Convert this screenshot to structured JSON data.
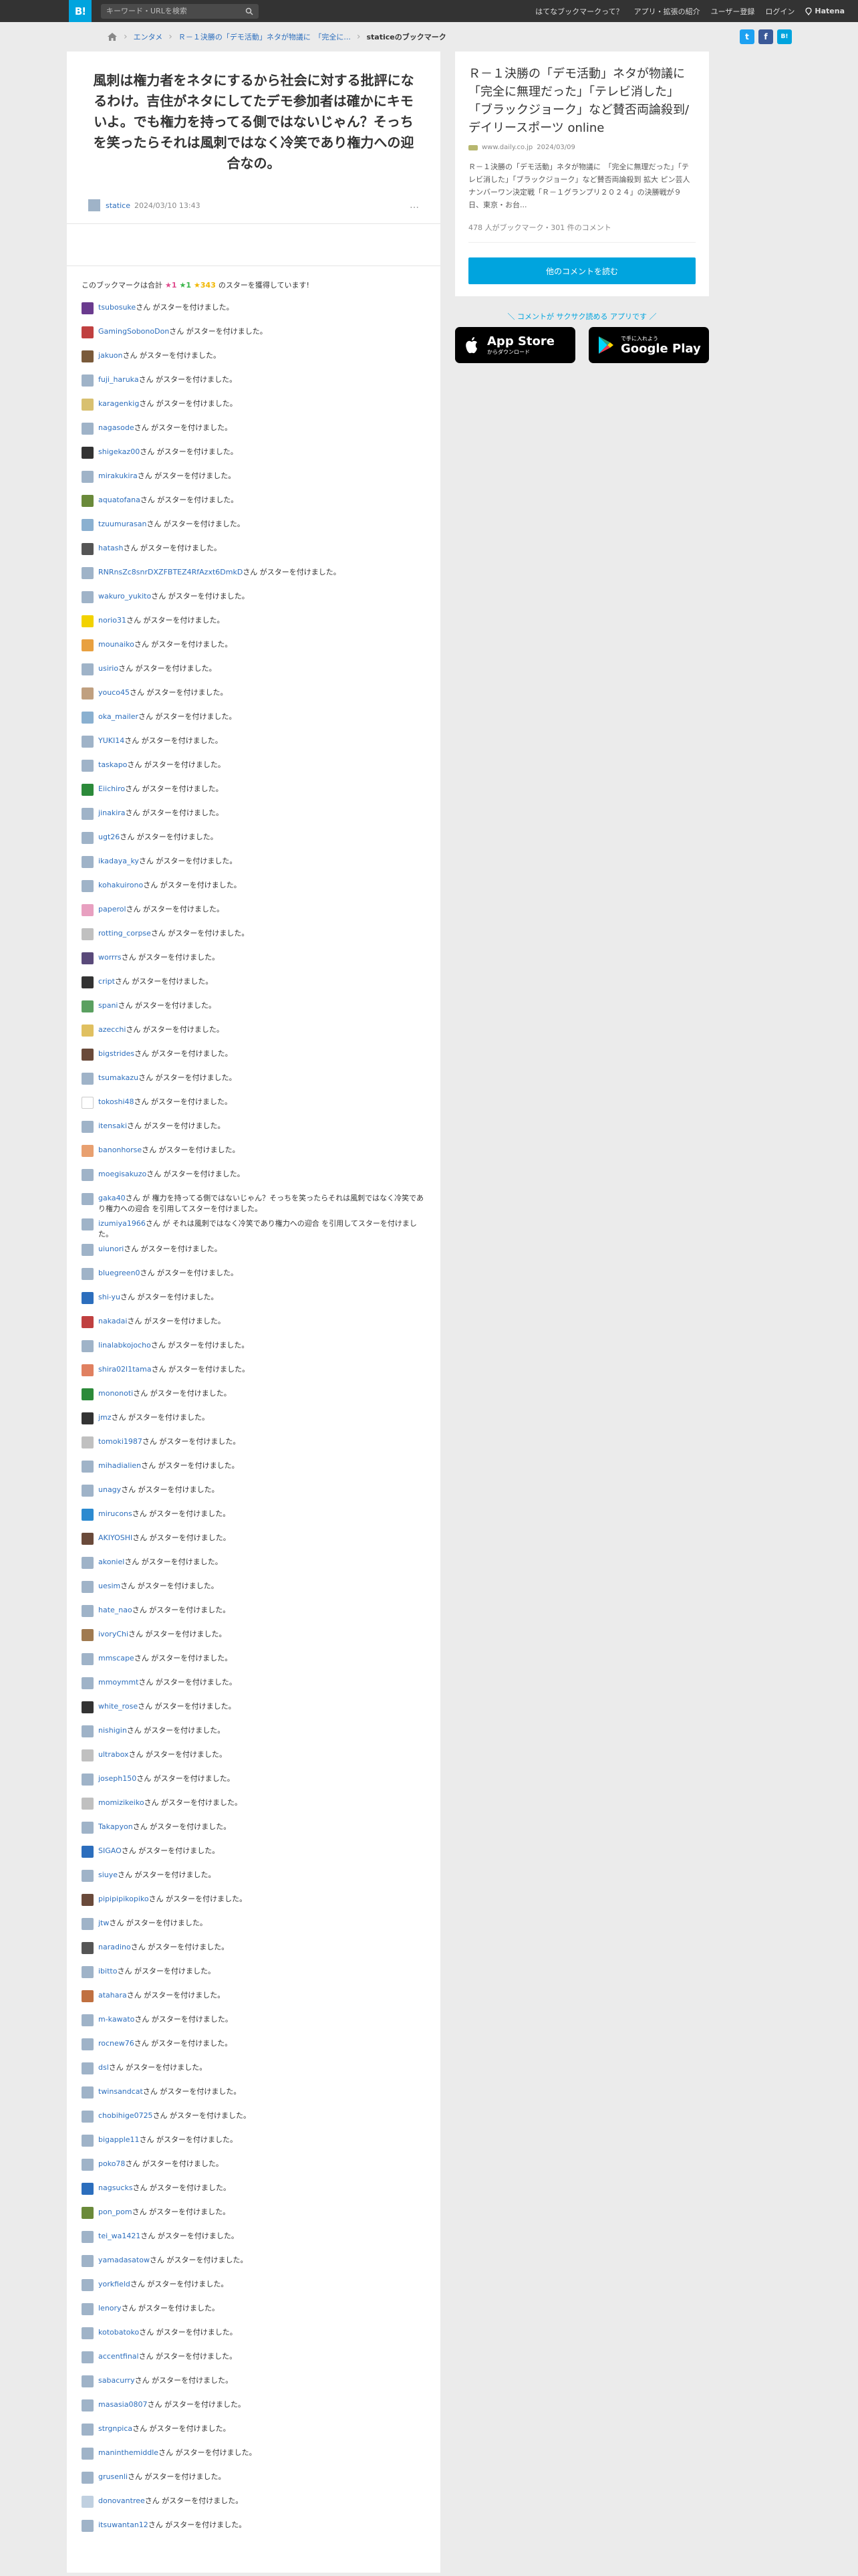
{
  "topbar": {
    "logo": "B!",
    "search_placeholder": "キーワード・URLを検索",
    "nav": [
      "はてなブックマークって？",
      "アプリ・拡張の紹介",
      "ユーザー登録",
      "ログイン"
    ],
    "hatena": "Hatena"
  },
  "breadcrumb": [
    "エンタメ",
    "Ｒ－１決勝の「デモ活動」ネタが物議に　「完全に...",
    "staticeのブックマーク"
  ],
  "comment": {
    "text": "風刺は権力者をネタにするから社会に対する批評になるわけ。吉住がネタにしてたデモ参加者は確かにキモいよ。でも権力を持ってる側ではないじゃん？そっちを笑ったらそれは風刺ではなく冷笑であり権力への迎合なの。",
    "user": "statice",
    "date": "2024/03/10 13:43",
    "more": "…"
  },
  "summary": {
    "prefix": "このブックマークは合計",
    "pink": "★1",
    "green": "★1",
    "yellow": "★343",
    "suffix": "のスターを獲得しています!"
  },
  "stars": [
    {
      "user": "tsubosuke",
      "text": "さん がスターを付けました。",
      "color": "#6a3b8e"
    },
    {
      "user": "GamingSobonoDon",
      "text": "さん がスターを付けました。",
      "color": "#c04040"
    },
    {
      "user": "jakuon",
      "text": "さん がスターを付けました。",
      "color": "#7a5a3a"
    },
    {
      "user": "fuji_haruka",
      "text": "さん がスターを付けました。",
      "color": "#9fb3c8"
    },
    {
      "user": "karagenkig",
      "text": "さん がスターを付けました。",
      "color": "#d8c070"
    },
    {
      "user": "nagasode",
      "text": "さん がスターを付けました。",
      "color": "#9fb3c8"
    },
    {
      "user": "shigekaz00",
      "text": "さん がスターを付けました。",
      "color": "#333333"
    },
    {
      "user": "mirakukira",
      "text": "さん がスターを付けました。",
      "color": "#9fb3c8"
    },
    {
      "user": "aquatofana",
      "text": "さん がスターを付けました。",
      "color": "#6a8a3a"
    },
    {
      "user": "tzuumurasan",
      "text": "さん がスターを付けました。",
      "color": "#8ab0d0"
    },
    {
      "user": "hatash",
      "text": "さん がスターを付けました。",
      "color": "#555555"
    },
    {
      "user": "RNRnsZc8snrDXZFBTEZ4RfAzxt6DmkD",
      "text": "さん がスターを付けました。",
      "color": "#9fb3c8"
    },
    {
      "user": "wakuro_yukito",
      "text": "さん がスターを付けました。",
      "color": "#9fb3c8"
    },
    {
      "user": "norio31",
      "text": "さん がスターを付けました。",
      "color": "#f2d200"
    },
    {
      "user": "mounaiko",
      "text": "さん がスターを付けました。",
      "color": "#e8a040"
    },
    {
      "user": "usirio",
      "text": "さん がスターを付けました。",
      "color": "#9fb3c8"
    },
    {
      "user": "youco45",
      "text": "さん がスターを付けました。",
      "color": "#c0a080"
    },
    {
      "user": "oka_mailer",
      "text": "さん がスターを付けました。",
      "color": "#8ab0d0"
    },
    {
      "user": "YUKI14",
      "text": "さん がスターを付けました。",
      "color": "#9fb3c8"
    },
    {
      "user": "taskapo",
      "text": "さん がスターを付けました。",
      "color": "#9fb3c8"
    },
    {
      "user": "Eiichiro",
      "text": "さん がスターを付けました。",
      "color": "#2c8a3a"
    },
    {
      "user": "jinakira",
      "text": "さん がスターを付けました。",
      "color": "#9fb3c8"
    },
    {
      "user": "ugt26",
      "text": "さん がスターを付けました。",
      "color": "#9fb3c8"
    },
    {
      "user": "ikadaya_ky",
      "text": "さん がスターを付けました。",
      "color": "#9fb3c8"
    },
    {
      "user": "kohakuirono",
      "text": "さん がスターを付けました。",
      "color": "#9fb3c8"
    },
    {
      "user": "paperol",
      "text": "さん がスターを付けました。",
      "color": "#e8a0c0"
    },
    {
      "user": "rotting_corpse",
      "text": "さん がスターを付けました。",
      "color": "#c0c0c0"
    },
    {
      "user": "worrrs",
      "text": "さん がスターを付けました。",
      "color": "#5a4a7a"
    },
    {
      "user": "cript",
      "text": "さん がスターを付けました。",
      "color": "#333333"
    },
    {
      "user": "spani",
      "text": "さん がスターを付けました。",
      "color": "#5aa060"
    },
    {
      "user": "azecchi",
      "text": "さん がスターを付けました。",
      "color": "#e0c060"
    },
    {
      "user": "bigstrides",
      "text": "さん がスターを付けました。",
      "color": "#6a4a3a"
    },
    {
      "user": "tsumakazu",
      "text": "さん がスターを付けました。",
      "color": "#9fb3c8"
    },
    {
      "user": "tokoshi48",
      "text": "さん がスターを付けました。",
      "color": "#ffffff"
    },
    {
      "user": "itensaki",
      "text": "さん がスターを付けました。",
      "color": "#9fb3c8"
    },
    {
      "user": "banonhorse",
      "text": "さん がスターを付けました。",
      "color": "#e8a070"
    },
    {
      "user": "moegisakuzo",
      "text": "さん がスターを付けました。",
      "color": "#9fb3c8"
    },
    {
      "user": "gaka40",
      "text": "さん が 権力を持ってる側ではないじゃん？そっちを笑ったらそれは風刺ではなく冷笑であり権力への迎合 を引用してスターを付けました。",
      "color": "#9fb3c8",
      "quote": true
    },
    {
      "user": "izumiya1966",
      "text": "さん が それは風刺ではなく冷笑であり権力への迎合 を引用してスターを付けました。",
      "color": "#9fb3c8",
      "quote": true
    },
    {
      "user": "uiunori",
      "text": "さん がスターを付けました。",
      "color": "#9fb3c8"
    },
    {
      "user": "bluegreen0",
      "text": "さん がスターを付けました。",
      "color": "#9fb3c8"
    },
    {
      "user": "shi-yu",
      "text": "さん がスターを付けました。",
      "color": "#2c6ebd"
    },
    {
      "user": "nakadai",
      "text": "さん がスターを付けました。",
      "color": "#c04040"
    },
    {
      "user": "linalabkojocho",
      "text": "さん がスターを付けました。",
      "color": "#9fb3c8"
    },
    {
      "user": "shira02l1tama",
      "text": "さん がスターを付けました。",
      "color": "#e08060"
    },
    {
      "user": "mononoti",
      "text": "さん がスターを付けました。",
      "color": "#2c8a3a"
    },
    {
      "user": "jmz",
      "text": "さん がスターを付けました。",
      "color": "#333333"
    },
    {
      "user": "tomoki1987",
      "text": "さん がスターを付けました。",
      "color": "#c0c0c0"
    },
    {
      "user": "mihadialien",
      "text": "さん がスターを付けました。",
      "color": "#9fb3c8"
    },
    {
      "user": "unagy",
      "text": "さん がスターを付けました。",
      "color": "#9fb3c8"
    },
    {
      "user": "mirucons",
      "text": "さん がスターを付けました。",
      "color": "#2c8ad0"
    },
    {
      "user": "AKIYOSHI",
      "text": "さん がスターを付けました。",
      "color": "#6a4a3a"
    },
    {
      "user": "akoniel",
      "text": "さん がスターを付けました。",
      "color": "#9fb3c8"
    },
    {
      "user": "uesim",
      "text": "さん がスターを付けました。",
      "color": "#9fb3c8"
    },
    {
      "user": "hate_nao",
      "text": "さん がスターを付けました。",
      "color": "#9fb3c8"
    },
    {
      "user": "ivoryChi",
      "text": "さん がスターを付けました。",
      "color": "#a07a50"
    },
    {
      "user": "mmscape",
      "text": "さん がスターを付けました。",
      "color": "#9fb3c8"
    },
    {
      "user": "mmoymmt",
      "text": "さん がスターを付けました。",
      "color": "#9fb3c8"
    },
    {
      "user": "white_rose",
      "text": "さん がスターを付けました。",
      "color": "#333333"
    },
    {
      "user": "nishigin",
      "text": "さん がスターを付けました。",
      "color": "#9fb3c8"
    },
    {
      "user": "ultrabox",
      "text": "さん がスターを付けました。",
      "color": "#c0c0c0"
    },
    {
      "user": "joseph150",
      "text": "さん がスターを付けました。",
      "color": "#9fb3c8"
    },
    {
      "user": "momizikeiko",
      "text": "さん がスターを付けました。",
      "color": "#c0c0c0"
    },
    {
      "user": "Takapyon",
      "text": "さん がスターを付けました。",
      "color": "#9fb3c8"
    },
    {
      "user": "SIGAO",
      "text": "さん がスターを付けました。",
      "color": "#2c6ebd"
    },
    {
      "user": "siuye",
      "text": "さん がスターを付けました。",
      "color": "#9fb3c8"
    },
    {
      "user": "pipipipikopiko",
      "text": "さん がスターを付けました。",
      "color": "#6a4a3a"
    },
    {
      "user": "jtw",
      "text": "さん がスターを付けました。",
      "color": "#9fb3c8"
    },
    {
      "user": "naradino",
      "text": "さん がスターを付けました。",
      "color": "#555555"
    },
    {
      "user": "ibitto",
      "text": "さん がスターを付けました。",
      "color": "#9fb3c8"
    },
    {
      "user": "atahara",
      "text": "さん がスターを付けました。",
      "color": "#c07040"
    },
    {
      "user": "m-kawato",
      "text": "さん がスターを付けました。",
      "color": "#9fb3c8"
    },
    {
      "user": "rocnew76",
      "text": "さん がスターを付けました。",
      "color": "#9fb3c8"
    },
    {
      "user": "dsl",
      "text": "さん がスターを付けました。",
      "color": "#9fb3c8"
    },
    {
      "user": "twinsandcat",
      "text": "さん がスターを付けました。",
      "color": "#9fb3c8"
    },
    {
      "user": "chobihige0725",
      "text": "さん がスターを付けました。",
      "color": "#9fb3c8"
    },
    {
      "user": "bigapple11",
      "text": "さん がスターを付けました。",
      "color": "#9fb3c8"
    },
    {
      "user": "poko78",
      "text": "さん がスターを付けました。",
      "color": "#9fb3c8"
    },
    {
      "user": "nagsucks",
      "text": "さん がスターを付けました。",
      "color": "#2c6ebd"
    },
    {
      "user": "pon_pom",
      "text": "さん がスターを付けました。",
      "color": "#6a8a3a"
    },
    {
      "user": "tei_wa1421",
      "text": "さん がスターを付けました。",
      "color": "#9fb3c8"
    },
    {
      "user": "yamadasatow",
      "text": "さん がスターを付けました。",
      "color": "#9fb3c8"
    },
    {
      "user": "yorkfield",
      "text": "さん がスターを付けました。",
      "color": "#9fb3c8"
    },
    {
      "user": "lenory",
      "text": "さん がスターを付けました。",
      "color": "#9fb3c8"
    },
    {
      "user": "kotobatoko",
      "text": "さん がスターを付けました。",
      "color": "#9fb3c8"
    },
    {
      "user": "accentfinal",
      "text": "さん がスターを付けました。",
      "color": "#9fb3c8"
    },
    {
      "user": "sabacurry",
      "text": "さん がスターを付けました。",
      "color": "#9fb3c8"
    },
    {
      "user": "masasia0807",
      "text": "さん がスターを付けました。",
      "color": "#9fb3c8"
    },
    {
      "user": "strgnpica",
      "text": "さん がスターを付けました。",
      "color": "#9fb3c8"
    },
    {
      "user": "maninthemiddle",
      "text": "さん がスターを付けました。",
      "color": "#9fb3c8"
    },
    {
      "user": "grusenli",
      "text": "さん がスターを付けました。",
      "color": "#9fb3c8"
    },
    {
      "user": "donovantree",
      "text": "さん がスターを付けました。",
      "color": "#c0d0e0"
    },
    {
      "user": "itsuwantan12",
      "text": "さん がスターを付けました。",
      "color": "#9fb3c8"
    }
  ],
  "sidebar": {
    "title": "Ｒ－１決勝の「デモ活動」ネタが物議に　「完全に無理だった」「テレビ消した」「ブラックジョーク」など賛否両論殺到/デイリースポーツ online",
    "site": "www.daily.co.jp",
    "date": "2024/03/09",
    "desc": "Ｒ－１決勝の「デモ活動」ネタが物議に　「完全に無理だった」「テレビ消した」「ブラックジョーク」など賛否両論殺到 拡大 ピン芸人ナンバーワン決定戦「Ｒ－１グランプリ２０２４」の決勝戦が９日、東京・お台...",
    "count": "478 人がブックマーク・301 件のコメント",
    "button": "他のコメントを読む",
    "app_tag": "＼ コメントが サクサク読める アプリです ／",
    "appstore_small": "からダウンロード",
    "appstore_big": "App Store",
    "gplay_small": "で手に入れよう",
    "gplay_big": "Google Play"
  }
}
